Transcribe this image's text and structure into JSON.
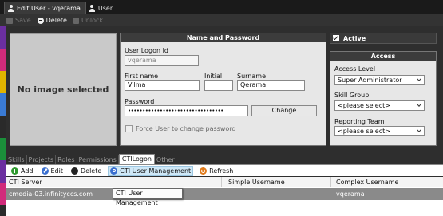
{
  "window_tabs": [
    {
      "label": "Edit User - vqerama",
      "icon": "user-icon"
    },
    {
      "label": "User",
      "icon": "user-icon"
    }
  ],
  "toolbar": {
    "save": "Save",
    "delete": "Delete",
    "unlock": "Unlock"
  },
  "left_strip_colors": [
    "#6b2fa0",
    "#d12b7b",
    "#e0b400",
    "#3a7bd5",
    "#2a2a2a",
    "#1b8f3a",
    "#6b2fa0",
    "#d12b7b"
  ],
  "image_placeholder": "No image selected",
  "name_panel": {
    "title": "Name and Password",
    "logon_label": "User Logon Id",
    "logon_value": "vqerama",
    "first_name_label": "First name",
    "first_name_value": "Vilma",
    "initial_label": "Initial",
    "initial_value": "",
    "surname_label": "Surname",
    "surname_value": "Qerama",
    "password_label": "Password",
    "password_value": "•••••••••••••••••••••••••••••••••",
    "change_button": "Change",
    "force_change_label": "Force User to change password"
  },
  "active": {
    "label": "Active",
    "checked": true
  },
  "access_panel": {
    "title": "Access",
    "access_level_label": "Access Level",
    "access_level_value": "Super Administrator",
    "skill_group_label": "Skill Group",
    "skill_group_value": "<please select>",
    "reporting_team_label": "Reporting Team",
    "reporting_team_value": "<please select>"
  },
  "section_tabs": [
    "Skills",
    "Projects",
    "Roles",
    "Permissions",
    "CTILogon",
    "Other"
  ],
  "active_section_tab": "CTILogon",
  "cti_toolbar": {
    "add": "Add",
    "edit": "Edit",
    "delete": "Delete",
    "manage": "CTI User Management",
    "refresh": "Refresh"
  },
  "cti_icon_colors": {
    "add": "#2e9a2e",
    "edit": "#3a6fcf",
    "delete": "#222222",
    "manage": "#3a6fcf",
    "refresh": "#e07a1a"
  },
  "grid": {
    "columns": [
      "CTI Server",
      "Simple Username",
      "Complex Username"
    ],
    "rows": [
      {
        "server": "cmedia-03.infinityccs.com",
        "simple": "",
        "complex": "vqerama"
      }
    ]
  },
  "tooltip": "CTI User Management"
}
